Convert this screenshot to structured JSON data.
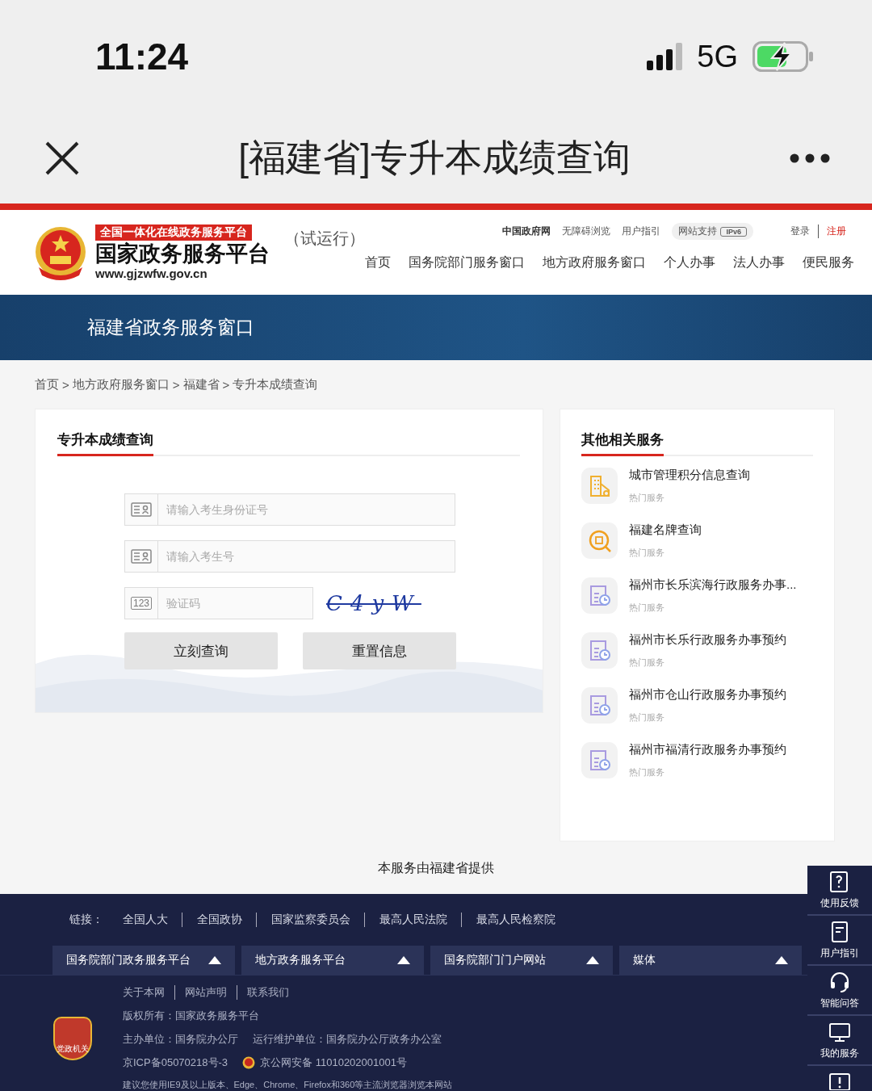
{
  "status_bar": {
    "time": "11:24",
    "network": "5G"
  },
  "nav_bar": {
    "title": "[福建省]专升本成绩查询"
  },
  "header": {
    "logo": {
      "tagline": "全国一体化在线政务服务平台",
      "name": "国家政务服务平台",
      "url": "www.gjzwfw.gov.cn"
    },
    "trial": "（试运行）",
    "top_links": [
      {
        "label": "中国政府网",
        "kind": "bold"
      },
      {
        "label": "无障碍浏览",
        "kind": "plain"
      },
      {
        "label": "用户指引",
        "kind": "plain"
      }
    ],
    "ipv6": {
      "label": "网站支持",
      "badge": "IPv6"
    },
    "account": [
      {
        "label": "登录",
        "kind": "plain"
      },
      {
        "label": "注册",
        "kind": "accent"
      }
    ],
    "nav": [
      "首页",
      "国务院部门服务窗口",
      "地方政府服务窗口",
      "个人办事",
      "法人办事",
      "便民服务"
    ]
  },
  "banner": {
    "title": "福建省政务服务窗口"
  },
  "breadcrumb": [
    {
      "label": "首页",
      "separator": ">"
    },
    {
      "label": "地方政府服务窗口",
      "separator": ">"
    },
    {
      "label": "福建省",
      "separator": ">"
    },
    {
      "label": "专升本成绩查询"
    }
  ],
  "form": {
    "title": "专升本成绩查询",
    "fields": [
      {
        "kind": "full",
        "placeholder": "请输入考生身份证号"
      },
      {
        "kind": "full",
        "placeholder": "请输入考生号"
      },
      {
        "kind": "captcha",
        "icon_text": "123",
        "placeholder": "验证码",
        "captcha": "C4yW"
      }
    ],
    "buttons": [
      "立刻查询",
      "重置信息"
    ]
  },
  "services": {
    "title": "其他相关服务",
    "items": [
      {
        "title": "城市管理积分信息查询",
        "tag": "热门服务",
        "kind": "building"
      },
      {
        "title": "福建名牌查询",
        "tag": "热门服务",
        "kind": "search"
      },
      {
        "title": "福州市长乐滨海行政服务办事...",
        "tag": "热门服务",
        "kind": "schedule"
      },
      {
        "title": "福州市长乐行政服务办事预约",
        "tag": "热门服务",
        "kind": "schedule"
      },
      {
        "title": "福州市仓山行政服务办事预约",
        "tag": "热门服务",
        "kind": "schedule"
      },
      {
        "title": "福州市福清行政服务办事预约",
        "tag": "热门服务",
        "kind": "schedule"
      }
    ]
  },
  "provider": "本服务由福建省提供",
  "footer": {
    "links_label": "链接：",
    "links": [
      "全国人大",
      "全国政协",
      "国家监察委员会",
      "最高人民法院",
      "最高人民检察院"
    ],
    "dropdowns": [
      "国务院部门政务服务平台",
      "地方政务服务平台",
      "国务院部门门户网站",
      "媒体"
    ],
    "about": [
      "关于本网",
      "网站声明",
      "联系我们"
    ],
    "badge": "党政机关",
    "copyright": "版权所有：国家政务服务平台",
    "sponsor": "主办单位：国务院办公厅",
    "operator": "运行维护单位：国务院办公厅政务办公室",
    "icp": "京ICP备05070218号-3",
    "police": "京公网安备 11010202001001号",
    "browser_note": "建议您使用IE9及以上版本、Edge、Chrome、Firefox和360等主流浏览器浏览本网站"
  },
  "side_panel": [
    {
      "kind": "feedback",
      "label": "使用反馈"
    },
    {
      "kind": "guide",
      "label": "用户指引"
    },
    {
      "kind": "headset",
      "label": "智能问答"
    },
    {
      "kind": "monitor",
      "label": "我的服务"
    },
    {
      "kind": "alert"
    }
  ]
}
